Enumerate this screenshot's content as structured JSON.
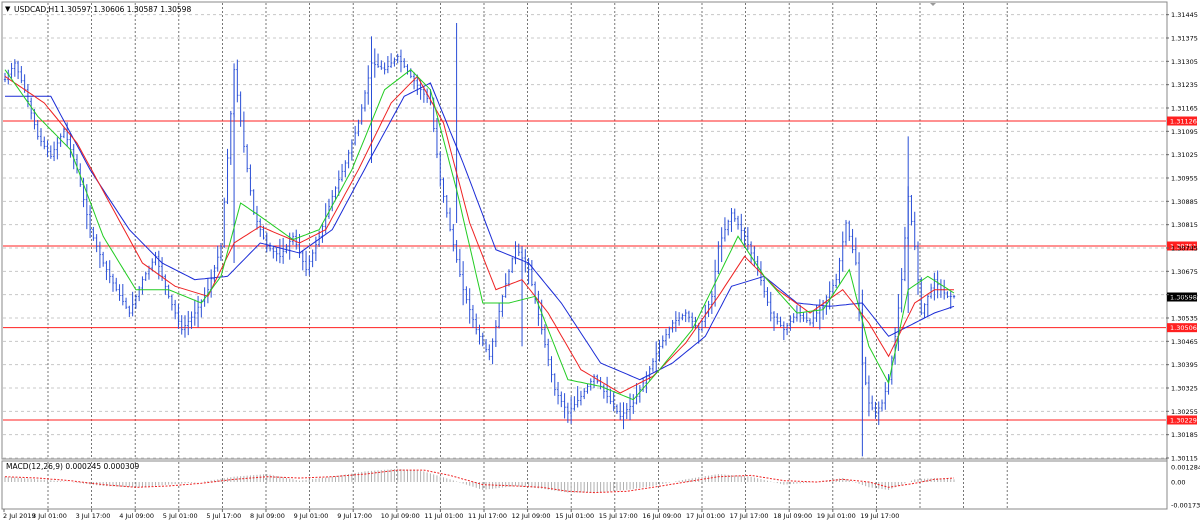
{
  "header": {
    "symbol_label": "USDCAD,H1",
    "ohlc_text": "1.30597 1.30606 1.30587 1.30598"
  },
  "colors": {
    "background": "#ffffff",
    "bars": "#2a4fd6",
    "ma_fast": "#22cc22",
    "ma_mid": "#ee2222",
    "ma_slow": "#1a2bd6",
    "levels": "#ff2020",
    "grid": "#c8c8c8",
    "macd_hist": "#b0b0b0",
    "macd_signal": "#ee2222"
  },
  "chart_data": [
    {
      "type": "line",
      "title": "USDCAD,H1",
      "ylim": [
        1.30115,
        1.3148
      ],
      "price_ticks": [
        "1.31445",
        "1.31375",
        "1.31305",
        "1.31235",
        "1.31165",
        "1.31095",
        "1.31025",
        "1.30955",
        "1.30885",
        "1.30815",
        "1.30745",
        "1.30675",
        "1.30605",
        "1.30535",
        "1.30465",
        "1.30395",
        "1.30325",
        "1.30255",
        "1.30185",
        "1.30115"
      ],
      "time_labels": [
        "2 Jul 2019",
        "3 Jul 01:00",
        "3 Jul 17:00",
        "4 Jul 09:00",
        "5 Jul 01:00",
        "5 Jul 17:00",
        "8 Jul 09:00",
        "9 Jul 01:00",
        "9 Jul 17:00",
        "10 Jul 09:00",
        "11 Jul 01:00",
        "11 Jul 17:00",
        "12 Jul 09:00",
        "15 Jul 01:00",
        "15 Jul 17:00",
        "16 Jul 09:00",
        "17 Jul 01:00",
        "17 Jul 17:00",
        "18 Jul 09:00",
        "19 Jul 01:00",
        "19 Jul 17:00"
      ],
      "horizontal_levels": [
        {
          "label": "1.31126",
          "value": 1.31126
        },
        {
          "label": "1.30751",
          "value": 1.30751
        },
        {
          "label": "1.30506",
          "value": 1.30506
        },
        {
          "label": "1.30229",
          "value": 1.30229
        }
      ],
      "current_price": {
        "label": "1.30598",
        "value": 1.30598
      },
      "price_path": [
        [
          0,
          1.3125
        ],
        [
          3,
          1.313
        ],
        [
          6,
          1.3122
        ],
        [
          10,
          1.3108
        ],
        [
          14,
          1.3102
        ],
        [
          18,
          1.311
        ],
        [
          22,
          1.3098
        ],
        [
          26,
          1.308
        ],
        [
          30,
          1.307
        ],
        [
          34,
          1.3062
        ],
        [
          38,
          1.3055
        ],
        [
          42,
          1.3065
        ],
        [
          46,
          1.3072
        ],
        [
          50,
          1.306
        ],
        [
          54,
          1.305
        ],
        [
          58,
          1.3055
        ],
        [
          62,
          1.3062
        ],
        [
          66,
          1.3075
        ],
        [
          70,
          1.3128
        ],
        [
          73,
          1.3105
        ],
        [
          76,
          1.3085
        ],
        [
          80,
          1.3075
        ],
        [
          84,
          1.3072
        ],
        [
          88,
          1.3078
        ],
        [
          92,
          1.3068
        ],
        [
          96,
          1.3078
        ],
        [
          100,
          1.309
        ],
        [
          104,
          1.31
        ],
        [
          108,
          1.3112
        ],
        [
          112,
          1.313
        ],
        [
          116,
          1.3128
        ],
        [
          120,
          1.3132
        ],
        [
          124,
          1.3126
        ],
        [
          127,
          1.3122
        ],
        [
          130,
          1.3118
        ],
        [
          133,
          1.3095
        ],
        [
          136,
          1.308
        ],
        [
          140,
          1.3062
        ],
        [
          144,
          1.305
        ],
        [
          148,
          1.3042
        ],
        [
          152,
          1.306
        ],
        [
          156,
          1.3075
        ],
        [
          160,
          1.3068
        ],
        [
          164,
          1.305
        ],
        [
          168,
          1.3032
        ],
        [
          172,
          1.3025
        ],
        [
          176,
          1.303
        ],
        [
          180,
          1.3036
        ],
        [
          184,
          1.303
        ],
        [
          188,
          1.3024
        ],
        [
          192,
          1.3028
        ],
        [
          196,
          1.3036
        ],
        [
          200,
          1.3045
        ],
        [
          204,
          1.3052
        ],
        [
          208,
          1.3055
        ],
        [
          212,
          1.305
        ],
        [
          216,
          1.306
        ],
        [
          218,
          1.3075
        ],
        [
          222,
          1.3085
        ],
        [
          226,
          1.3078
        ],
        [
          230,
          1.3068
        ],
        [
          234,
          1.3055
        ],
        [
          238,
          1.305
        ],
        [
          242,
          1.3055
        ],
        [
          246,
          1.3052
        ],
        [
          250,
          1.3058
        ],
        [
          254,
          1.3065
        ],
        [
          257,
          1.3082
        ],
        [
          260,
          1.307
        ],
        [
          262,
          1.304
        ],
        [
          264,
          1.3028
        ],
        [
          266,
          1.3025
        ],
        [
          268,
          1.3028
        ],
        [
          270,
          1.3035
        ],
        [
          272,
          1.3048
        ],
        [
          274,
          1.3065
        ],
        [
          276,
          1.309
        ],
        [
          278,
          1.3075
        ],
        [
          280,
          1.3055
        ],
        [
          282,
          1.306
        ],
        [
          284,
          1.3065
        ],
        [
          286,
          1.3062
        ],
        [
          288,
          1.306
        ],
        [
          290,
          1.306
        ]
      ],
      "ma_fast": [
        [
          0,
          1.3128
        ],
        [
          10,
          1.3114
        ],
        [
          20,
          1.3104
        ],
        [
          30,
          1.3078
        ],
        [
          40,
          1.3062
        ],
        [
          50,
          1.3062
        ],
        [
          60,
          1.3058
        ],
        [
          66,
          1.3066
        ],
        [
          72,
          1.3088
        ],
        [
          78,
          1.3084
        ],
        [
          88,
          1.3077
        ],
        [
          96,
          1.308
        ],
        [
          106,
          1.3098
        ],
        [
          116,
          1.3122
        ],
        [
          124,
          1.3128
        ],
        [
          130,
          1.3122
        ],
        [
          138,
          1.3092
        ],
        [
          146,
          1.3058
        ],
        [
          154,
          1.3058
        ],
        [
          162,
          1.306
        ],
        [
          172,
          1.3035
        ],
        [
          182,
          1.3033
        ],
        [
          192,
          1.3029
        ],
        [
          200,
          1.3038
        ],
        [
          210,
          1.305
        ],
        [
          218,
          1.3066
        ],
        [
          224,
          1.3078
        ],
        [
          232,
          1.3066
        ],
        [
          242,
          1.3055
        ],
        [
          250,
          1.3056
        ],
        [
          258,
          1.3068
        ],
        [
          264,
          1.3045
        ],
        [
          270,
          1.3034
        ],
        [
          276,
          1.3062
        ],
        [
          282,
          1.3066
        ],
        [
          290,
          1.3061
        ]
      ],
      "ma_mid": [
        [
          0,
          1.3126
        ],
        [
          12,
          1.3118
        ],
        [
          22,
          1.3106
        ],
        [
          32,
          1.3088
        ],
        [
          42,
          1.307
        ],
        [
          52,
          1.3063
        ],
        [
          62,
          1.306
        ],
        [
          70,
          1.3076
        ],
        [
          78,
          1.3081
        ],
        [
          90,
          1.3076
        ],
        [
          98,
          1.308
        ],
        [
          108,
          1.3098
        ],
        [
          118,
          1.3118
        ],
        [
          126,
          1.3126
        ],
        [
          134,
          1.3112
        ],
        [
          142,
          1.3082
        ],
        [
          150,
          1.3062
        ],
        [
          158,
          1.3065
        ],
        [
          166,
          1.3055
        ],
        [
          176,
          1.3038
        ],
        [
          188,
          1.3031
        ],
        [
          198,
          1.3036
        ],
        [
          208,
          1.3046
        ],
        [
          218,
          1.306
        ],
        [
          226,
          1.3072
        ],
        [
          236,
          1.3062
        ],
        [
          246,
          1.3055
        ],
        [
          256,
          1.3062
        ],
        [
          264,
          1.3052
        ],
        [
          270,
          1.3042
        ],
        [
          278,
          1.3058
        ],
        [
          284,
          1.3062
        ],
        [
          290,
          1.3062
        ]
      ],
      "ma_slow": [
        [
          0,
          1.312
        ],
        [
          14,
          1.312
        ],
        [
          26,
          1.3098
        ],
        [
          38,
          1.308
        ],
        [
          48,
          1.307
        ],
        [
          58,
          1.3065
        ],
        [
          68,
          1.3066
        ],
        [
          78,
          1.3076
        ],
        [
          90,
          1.3073
        ],
        [
          100,
          1.308
        ],
        [
          112,
          1.3102
        ],
        [
          122,
          1.312
        ],
        [
          130,
          1.3124
        ],
        [
          140,
          1.31
        ],
        [
          150,
          1.3074
        ],
        [
          160,
          1.307
        ],
        [
          170,
          1.3058
        ],
        [
          182,
          1.304
        ],
        [
          194,
          1.3035
        ],
        [
          204,
          1.304
        ],
        [
          214,
          1.3048
        ],
        [
          222,
          1.3063
        ],
        [
          232,
          1.3066
        ],
        [
          242,
          1.3058
        ],
        [
          252,
          1.3057
        ],
        [
          262,
          1.3058
        ],
        [
          270,
          1.3048
        ],
        [
          278,
          1.3052
        ],
        [
          284,
          1.3055
        ],
        [
          290,
          1.3057
        ]
      ]
    },
    {
      "type": "bar",
      "title": "MACD(12,26,9) 0.000245 0.000309",
      "ylim": [
        -0.001738,
        0.001284
      ],
      "y_ticks": [
        "0.001284",
        "0.00",
        "-0.001738"
      ],
      "histogram": [
        [
          0,
          0.0004
        ],
        [
          10,
          0.0002
        ],
        [
          20,
          0.0
        ],
        [
          30,
          -0.0003
        ],
        [
          40,
          -0.0004
        ],
        [
          50,
          -0.0002
        ],
        [
          60,
          0.0
        ],
        [
          70,
          0.0004
        ],
        [
          80,
          0.0006
        ],
        [
          90,
          0.0001
        ],
        [
          100,
          0.0004
        ],
        [
          110,
          0.0008
        ],
        [
          120,
          0.001
        ],
        [
          128,
          0.0008
        ],
        [
          136,
          0.0002
        ],
        [
          146,
          -0.0006
        ],
        [
          156,
          -0.0003
        ],
        [
          164,
          -0.0005
        ],
        [
          172,
          -0.0008
        ],
        [
          180,
          -0.0008
        ],
        [
          190,
          -0.0006
        ],
        [
          198,
          -0.0003
        ],
        [
          208,
          0.0002
        ],
        [
          218,
          0.0006
        ],
        [
          228,
          0.0004
        ],
        [
          238,
          -0.0002
        ],
        [
          248,
          0.0
        ],
        [
          256,
          0.0003
        ],
        [
          264,
          -0.0004
        ],
        [
          270,
          -0.0006
        ],
        [
          278,
          0.0002
        ],
        [
          284,
          0.0003
        ],
        [
          290,
          0.0002
        ]
      ],
      "signal": [
        [
          0,
          0.0004
        ],
        [
          10,
          0.0003
        ],
        [
          20,
          0.0001
        ],
        [
          30,
          -0.0002
        ],
        [
          40,
          -0.0004
        ],
        [
          50,
          -0.0003
        ],
        [
          60,
          -0.0001
        ],
        [
          70,
          0.0002
        ],
        [
          80,
          0.0004
        ],
        [
          90,
          0.0003
        ],
        [
          100,
          0.0004
        ],
        [
          110,
          0.0006
        ],
        [
          120,
          0.0009
        ],
        [
          128,
          0.0009
        ],
        [
          136,
          0.0005
        ],
        [
          146,
          -0.0002
        ],
        [
          156,
          -0.0003
        ],
        [
          164,
          -0.0004
        ],
        [
          172,
          -0.0007
        ],
        [
          180,
          -0.0008
        ],
        [
          190,
          -0.0007
        ],
        [
          198,
          -0.0004
        ],
        [
          208,
          0.0
        ],
        [
          218,
          0.0004
        ],
        [
          228,
          0.0005
        ],
        [
          238,
          0.0001
        ],
        [
          248,
          0.0
        ],
        [
          256,
          0.0002
        ],
        [
          264,
          0.0
        ],
        [
          270,
          -0.0004
        ],
        [
          278,
          -0.0001
        ],
        [
          284,
          0.0002
        ],
        [
          290,
          0.0003
        ]
      ]
    }
  ]
}
